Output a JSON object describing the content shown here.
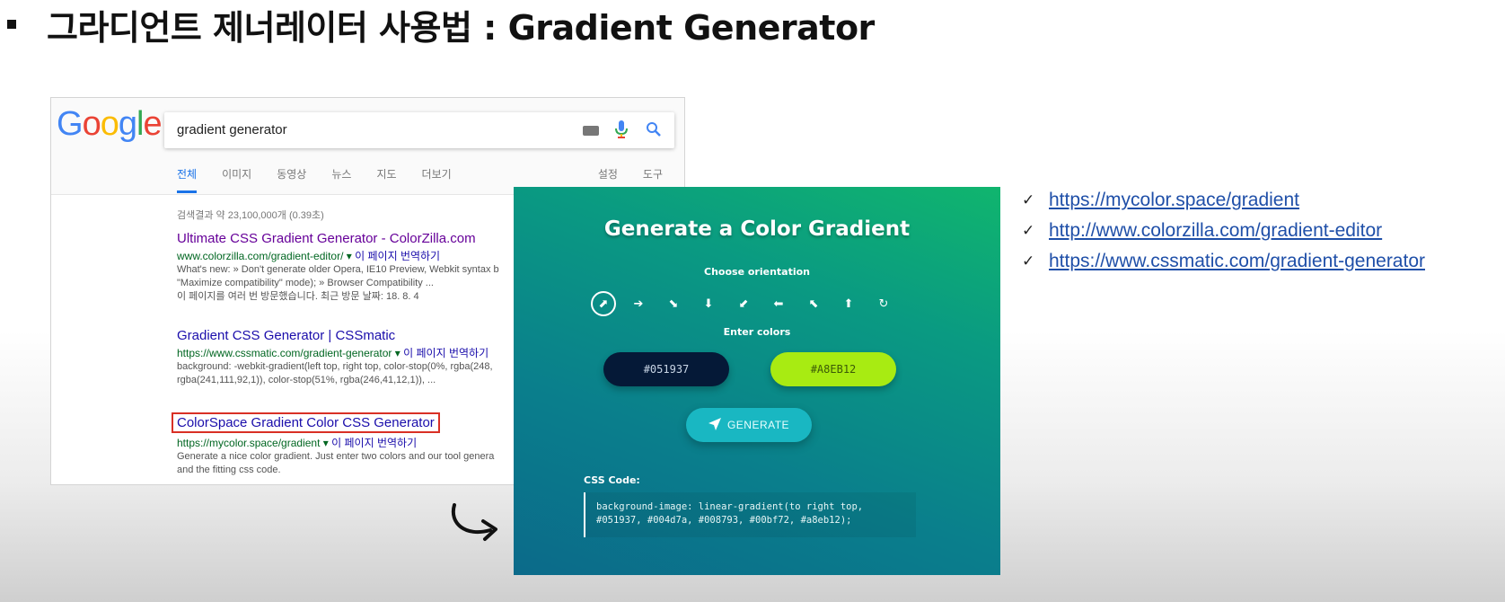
{
  "slide": {
    "title": "그라디언트 제너레이터 사용법 : Gradient Generator"
  },
  "google": {
    "logo_letters": [
      "G",
      "o",
      "o",
      "g",
      "l",
      "e"
    ],
    "search_value": "gradient generator",
    "tabs": [
      "전체",
      "이미지",
      "동영상",
      "뉴스",
      "지도",
      "더보기"
    ],
    "tools": [
      "설정",
      "도구"
    ],
    "stats": "검색결과 약 23,100,000개 (0.39초)",
    "results": [
      {
        "title": "Ultimate CSS Gradient Generator - ColorZilla.com",
        "url": "www.colorzilla.com/gradient-editor/ ▾",
        "translate": "이 페이지 번역하기",
        "snippet": [
          "What's new: » Don't generate older Opera, IE10 Preview, Webkit syntax b",
          "\"Maximize compatibility\" mode); » Browser Compatibility ...",
          "이 페이지를 여러 번 방문했습니다. 최근 방문 날짜: 18. 8. 4"
        ]
      },
      {
        "title": "Gradient CSS Generator | CSSmatic",
        "url": "https://www.cssmatic.com/gradient-generator ▾",
        "translate": "이 페이지 번역하기",
        "snippet": [
          "background: -webkit-gradient(left top, right top, color-stop(0%, rgba(248,",
          "rgba(241,111,92,1)), color-stop(51%, rgba(246,41,12,1)), ..."
        ]
      },
      {
        "title": "ColorSpace Gradient Color CSS Generator",
        "url": "https://mycolor.space/gradient ▾",
        "translate": "이 페이지 번역하기",
        "snippet": [
          "Generate a nice color gradient. Just enter two colors and our tool genera",
          "and the fitting css code."
        ]
      }
    ]
  },
  "colorspace": {
    "title": "Generate a Color Gradient",
    "orientation_label": "Choose orientation",
    "directions": [
      "⬈",
      "➔",
      "⬊",
      "⬇",
      "⬋",
      "⬅",
      "⬉",
      "⬆",
      "↻"
    ],
    "colors_label": "Enter colors",
    "color1": "#051937",
    "color2": "#A8EB12",
    "generate_label": "GENERATE",
    "code_label": "CSS Code:",
    "code_line1": "background-image: linear-gradient(to right top,",
    "code_line2": "#051937, #004d7a, #008793, #00bf72, #a8eb12);"
  },
  "links": [
    "https://mycolor.space/gradient",
    "http://www.colorzilla.com/gradient-editor",
    "https://www.cssmatic.com/gradient-generator"
  ],
  "check_glyph": "✓"
}
